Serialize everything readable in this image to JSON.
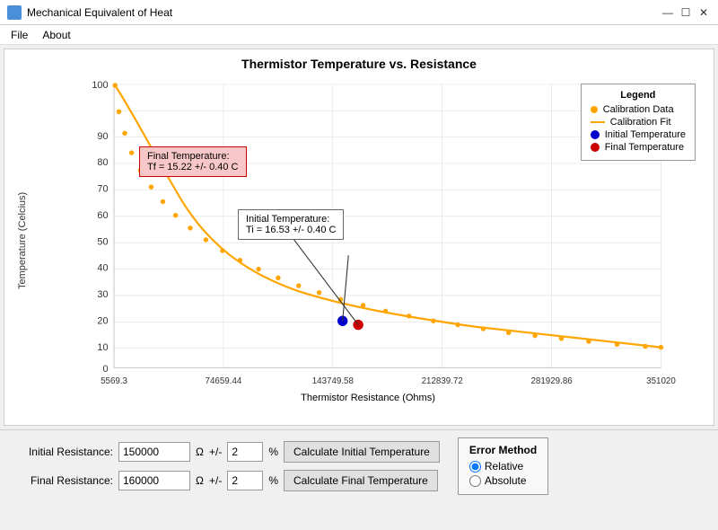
{
  "window": {
    "title": "Mechanical Equivalent of Heat",
    "controls": {
      "minimize": "—",
      "maximize": "☐",
      "close": "✕"
    }
  },
  "menu": {
    "items": [
      "File",
      "About"
    ]
  },
  "chart": {
    "title": "Thermistor Temperature vs. Resistance",
    "y_axis_label": "Temperature (Celcius)",
    "x_axis_label": "Thermistor Resistance (Ohms)",
    "x_ticks": [
      "5569.3",
      "74659.44",
      "143749.58",
      "212839.72",
      "281929.86",
      "351020"
    ],
    "y_ticks": [
      "0",
      "10",
      "20",
      "30",
      "40",
      "50",
      "60",
      "70",
      "80",
      "90",
      "100"
    ],
    "legend": {
      "title": "Legend",
      "items": [
        {
          "label": "Calibration Data",
          "type": "dot-orange"
        },
        {
          "label": "Calibration Fit",
          "type": "line-orange"
        },
        {
          "label": "Initial Temperature",
          "type": "dot-blue"
        },
        {
          "label": "Final Temperature",
          "type": "dot-red"
        }
      ]
    },
    "tooltip_final": {
      "line1": "Final Temperature:",
      "line2": "Tf = 15.22 +/- 0.40 C"
    },
    "tooltip_initial": {
      "line1": "Initial Temperature:",
      "line2": "Ti = 16.53 +/- 0.40 C"
    }
  },
  "bottom": {
    "initial_resistance_label": "Initial Resistance:",
    "initial_resistance_value": "150000",
    "final_resistance_label": "Final Resistance:",
    "final_resistance_value": "160000",
    "omega_symbol": "Ω",
    "plus_minus": "+/-",
    "percent": "%",
    "error_value_initial": "2",
    "error_value_final": "2",
    "calc_initial_btn": "Calculate Initial Temperature",
    "calc_final_btn": "Calculate Final Temperature",
    "error_method": {
      "title": "Error Method",
      "options": [
        "Relative",
        "Absolute"
      ],
      "selected": "Relative"
    }
  }
}
